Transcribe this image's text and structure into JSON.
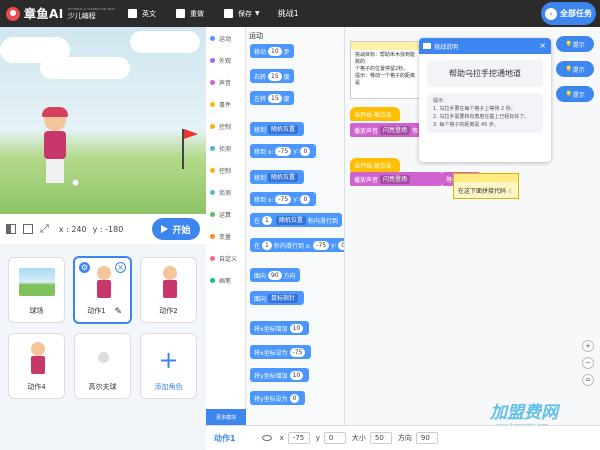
{
  "header": {
    "brand": "章鱼AI",
    "brand_tagline": "OCTOPUS AI CODING FOR KIDS",
    "brand_sub": "少儿编程",
    "menu": {
      "language": "英文",
      "reset": "重做",
      "save": "保存"
    },
    "project_title": "挑战1",
    "all_tasks": "全部任务"
  },
  "stage": {
    "coord_x": "x : 240",
    "coord_y": "y : -180",
    "start_label": "开始"
  },
  "sprites": [
    {
      "label": "球场"
    },
    {
      "label": "动作1",
      "selected": true
    },
    {
      "label": "动作2"
    },
    {
      "label": "动作4"
    },
    {
      "label": "高尔夫球"
    },
    {
      "label": "添加角色"
    }
  ],
  "categories": [
    {
      "label": "运动",
      "color": "#4c97ff"
    },
    {
      "label": "外观",
      "color": "#9966ff"
    },
    {
      "label": "声音",
      "color": "#cf63cf"
    },
    {
      "label": "事件",
      "color": "#ffbf00"
    },
    {
      "label": "控制",
      "color": "#ffab19"
    },
    {
      "label": "侦测",
      "color": "#5cb1d6"
    },
    {
      "label": "控制",
      "color": "#ffab19"
    },
    {
      "label": "侦测",
      "color": "#5cb1d6"
    },
    {
      "label": "运算",
      "color": "#59c059"
    },
    {
      "label": "变量",
      "color": "#ff8c1a"
    },
    {
      "label": "自定义",
      "color": "#ff6680"
    },
    {
      "label": "画笔",
      "color": "#0fbd8c"
    }
  ],
  "more_blocks": "更多模块",
  "palette": {
    "title": "运动",
    "blocks": [
      {
        "a": "移动",
        "v1": "10",
        "b": "步"
      },
      {
        "a": "右转",
        "v1": "15",
        "b": "度"
      },
      {
        "a": "左转",
        "v1": "15",
        "b": "度"
      },
      {
        "a": "移到",
        "d1": "随机位置"
      },
      {
        "a": "移到 x:",
        "v1": "-75",
        "b": "y:",
        "v2": "0"
      },
      {
        "a": "移到",
        "d1": "随机位置"
      },
      {
        "a": "移到 x:",
        "v1": "-75",
        "b": "y:",
        "v2": "0"
      },
      {
        "a": "在",
        "v1": "1",
        "b": "秒内滑行到",
        "d1": "随机位置"
      },
      {
        "a": "在",
        "v1": "1",
        "b": "秒内滑行到 x:",
        "v2": "-75",
        "c": "y:",
        "v3": "0"
      },
      {
        "a": "面向",
        "v1": "90",
        "b": "方向"
      },
      {
        "a": "面向",
        "d1": "鼠标指针"
      },
      {
        "a": "将x坐标增加",
        "v1": "10"
      },
      {
        "a": "将x坐标设为",
        "v1": "-75"
      },
      {
        "a": "将y坐标增加",
        "v1": "10"
      },
      {
        "a": "将y坐标设为",
        "v1": "0"
      }
    ]
  },
  "workspace": {
    "note_lines": [
      "挑战目标：帮助禾木找到能跳的",
      "个格子的位置停留2秒。",
      "提示：移动一个格子的距离是"
    ],
    "event1": "当开始 被点击",
    "sound1_a": "播放声音",
    "sound1_b": "闪亮登场",
    "sound1_c": "等",
    "event2": "当开始 被点击",
    "sound2_a": "播放声音",
    "sound2_b": "闪亮登场",
    "sound2_c": "等待播完",
    "bubble": "在这下面拼接代码",
    "bubble_icon": "hand-pointer-icon"
  },
  "challenge_panel": {
    "header": "挑战说明",
    "goal": "帮助乌拉手挖通地道",
    "hint_title": "提示:",
    "hints": [
      "1. 乌拉手要在每个格子上等待 2 秒。",
      "2. 乌拉手需要转向角度在垂上已经标好了。",
      "3. 每个格子的距离是 45 步。"
    ]
  },
  "hint_buttons": [
    "提示",
    "提示",
    "提示"
  ],
  "bottom": {
    "sprite_name": "动作1",
    "x_label": "x",
    "x": "-75",
    "y_label": "y",
    "y": "0",
    "size_label": "大小",
    "size": "50",
    "dir_label": "方向",
    "dir": "90"
  },
  "watermark": {
    "text": "加盟费网",
    "url": "www.jiamengfei.com"
  }
}
